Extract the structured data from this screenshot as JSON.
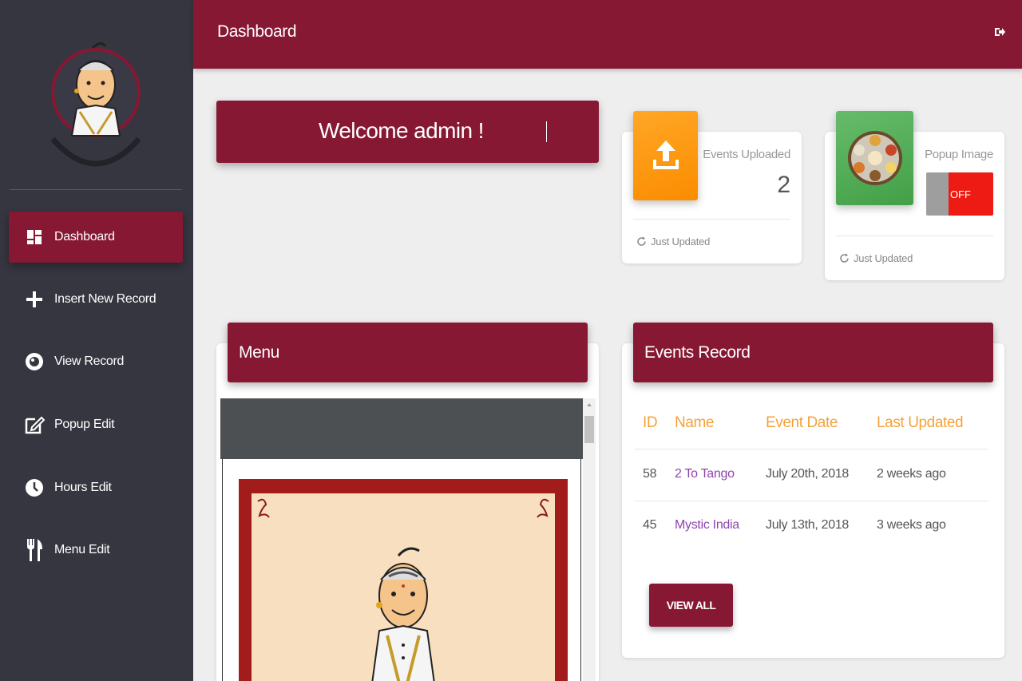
{
  "colors": {
    "brand": "#861833",
    "sidebar": "#363640",
    "accent_orange": "#f5a23a",
    "link_purple": "#8e44ad",
    "toggle_off": "#ee1a14"
  },
  "sidebar": {
    "items": [
      {
        "label": "Dashboard",
        "icon": "dashboard-icon",
        "active": true
      },
      {
        "label": "Insert New Record",
        "icon": "plus-icon"
      },
      {
        "label": "View Record",
        "icon": "eye-icon"
      },
      {
        "label": "Popup Edit",
        "icon": "edit-icon"
      },
      {
        "label": "Hours Edit",
        "icon": "clock-icon"
      },
      {
        "label": "Menu Edit",
        "icon": "cutlery-icon"
      }
    ]
  },
  "header": {
    "title": "Dashboard",
    "logout_icon": "logout-icon"
  },
  "welcome": {
    "text": "Welcome admin !"
  },
  "stats": {
    "events": {
      "label": "Events Uploaded",
      "value": "2",
      "footer": "Just Updated",
      "icon": "upload-icon"
    },
    "popup": {
      "label": "Popup Image",
      "toggle": "OFF",
      "footer": "Just Updated",
      "icon": "food-plate-image"
    }
  },
  "menu_card": {
    "title": "Menu"
  },
  "events_card": {
    "title": "Events Record",
    "columns": [
      "ID",
      "Name",
      "Event Date",
      "Last Updated"
    ],
    "rows": [
      {
        "id": "58",
        "name": "2 To Tango",
        "date": "July 20th, 2018",
        "updated": "2 weeks ago"
      },
      {
        "id": "45",
        "name": "Mystic India",
        "date": "July 13th, 2018",
        "updated": "3 weeks ago"
      }
    ],
    "view_all": "VIEW ALL"
  }
}
